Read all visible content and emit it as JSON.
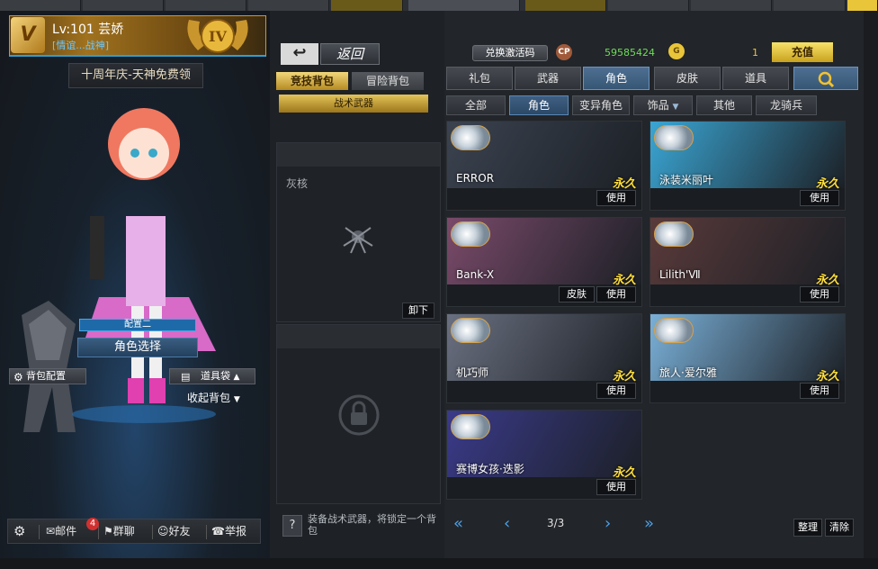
{
  "player": {
    "level_name": "Lv:101 芸娇",
    "guild": "[情谊...战神]",
    "rank_badge": "IV"
  },
  "promo": {
    "text": "十周年庆-天神免费领"
  },
  "loadout": {
    "config_label": "配置二",
    "role_select_label": "角色选择",
    "bag_config_label": "背包配置",
    "item_box_label": "道具袋",
    "collapse_label": "收起背包"
  },
  "bottom_bar": {
    "mail": "邮件",
    "mail_count": "4",
    "group_chat": "群聊",
    "friends": "好友",
    "report": "举报"
  },
  "middle": {
    "back_label": "返回",
    "tab_competitive": "竞技背包",
    "tab_adventure": "冒险背包",
    "tactical_weapon": "战术武器",
    "slot1_name": "灰核",
    "unload_label": "卸下",
    "hint": "装备战术武器，将锁定一个背包"
  },
  "currency": {
    "redeem_label": "兑换激活码",
    "cp_icon": "CP",
    "cp_value": "59585424",
    "g_icon": "G",
    "g_value": "1",
    "recharge_label": "充值"
  },
  "categories": [
    "礼包",
    "武器",
    "角色",
    "皮肤",
    "道具"
  ],
  "subcategories": [
    "全部",
    "角色",
    "变异角色",
    "饰品",
    "其他",
    "龙骑兵"
  ],
  "cards": [
    {
      "name": "ERROR",
      "perm": "永久",
      "use": "使用",
      "skin": "",
      "theme": "#3b4350"
    },
    {
      "name": "泳装米丽叶",
      "perm": "永久",
      "use": "使用",
      "skin": "",
      "theme": "#3aa6d4"
    },
    {
      "name": "Bank-X",
      "perm": "永久",
      "use": "使用",
      "skin": "皮肤",
      "theme": "#7a4a6a"
    },
    {
      "name": "Lilith'Ⅶ",
      "perm": "永久",
      "use": "使用",
      "skin": "",
      "theme": "#5a3a3a"
    },
    {
      "name": "机巧师",
      "perm": "永久",
      "use": "使用",
      "skin": "",
      "theme": "#6a7080"
    },
    {
      "name": "旅人·爱尔雅",
      "perm": "永久",
      "use": "使用",
      "skin": "",
      "theme": "#7ab0d8"
    },
    {
      "name": "赛博女孩·迭影",
      "perm": "永久",
      "use": "使用",
      "skin": "",
      "theme": "#3a3a8a"
    }
  ],
  "pager": {
    "page": "3/3"
  },
  "actions": {
    "sort": "整理",
    "clear": "清除"
  }
}
